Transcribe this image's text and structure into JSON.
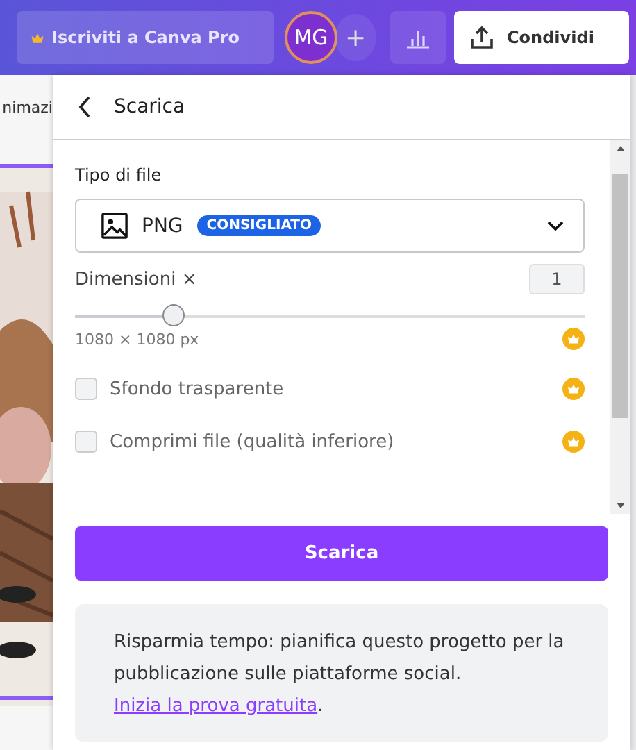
{
  "topbar": {
    "upgrade": "Iscriviti a Canva Pro",
    "avatar": "MG",
    "add": "+",
    "share": "Condividi"
  },
  "behind": {
    "tab": "nimazi"
  },
  "panel": {
    "title": "Scarica",
    "file_type_label": "Tipo di file",
    "file_type": {
      "value": "PNG",
      "badge": "CONSIGLIATO"
    },
    "size_label": "Dimensioni ×",
    "size_value": "1",
    "size": {
      "level": 0.2,
      "reading": "1080 × 1080 px",
      "pro": true
    },
    "options": [
      {
        "label": "Sfondo trasparente",
        "checked": false,
        "pro": true
      },
      {
        "label": "Comprimi file (qualità inferiore)",
        "checked": false,
        "pro": true
      }
    ],
    "button": "Scarica",
    "promo": {
      "text": "Risparmia tempo: pianifica questo progetto per la pubblicazione sulle piattaforme social. ",
      "link": "Inizia la prova gratuita",
      "end": "."
    }
  }
}
